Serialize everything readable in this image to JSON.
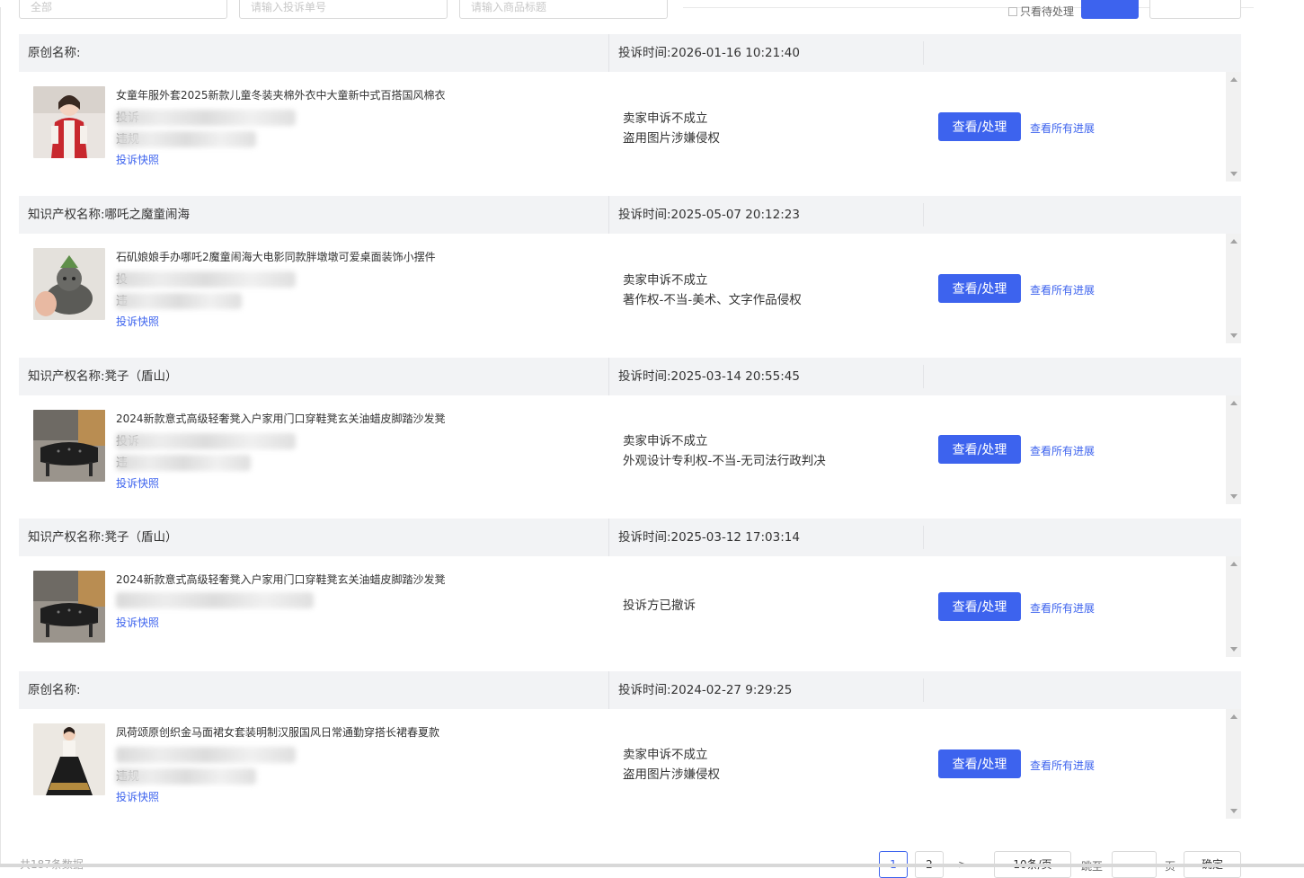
{
  "filters": {
    "f1_placeholder": "全部",
    "f2_placeholder": "请输入投诉单号",
    "f3_placeholder": "请输入商品标题",
    "checkbox_label": "只看待处理",
    "search_label": "",
    "export_label": ""
  },
  "labels": {
    "view_button": "查看/处理",
    "progress_link": "查看所有进展",
    "snapshot_link": "投诉快照",
    "complaint_prefix": "投诉",
    "violation_prefix": "违规"
  },
  "complaints": [
    {
      "header_title": "原创名称:",
      "time": "投诉时间:2026-01-16 10:21:40",
      "product_title": "女童年服外套2025新款儿童冬装夹棉外衣中大童新中式百搭国风棉衣",
      "row1_label": "投诉",
      "row2_label": "违规",
      "status_line1": "卖家申诉不成立",
      "status_line2": "盗用图片涉嫌侵权",
      "thumb_icon": "product-thumbnail-girl-jacket"
    },
    {
      "header_title": "知识产权名称:哪吒之魔童闹海",
      "time": "投诉时间:2025-05-07 20:12:23",
      "product_title": "石矶娘娘手办哪吒2魔童闹海大电影同款胖墩墩可爱桌面装饰小摆件",
      "row1_label": "投",
      "row2_label": "违",
      "status_line1": "卖家申诉不成立",
      "status_line2": "著作权-不当-美术、文字作品侵权",
      "thumb_icon": "product-thumbnail-figurine"
    },
    {
      "header_title": "知识产权名称:凳子（盾山）",
      "time": "投诉时间:2025-03-14 20:55:45",
      "product_title": "2024新款意式高级轻奢凳入户家用门口穿鞋凳玄关油蜡皮脚踏沙发凳",
      "row1_label": "投诉",
      "row2_label": "违",
      "status_line1": "卖家申诉不成立",
      "status_line2": "外观设计专利权-不当-无司法行政判决",
      "thumb_icon": "product-thumbnail-stool"
    },
    {
      "header_title": "知识产权名称:凳子（盾山）",
      "time": "投诉时间:2025-03-12 17:03:14",
      "product_title": "2024新款意式高级轻奢凳入户家用门口穿鞋凳玄关油蜡皮脚踏沙发凳",
      "row1_label": "",
      "row2_label": "",
      "status_line1": "投诉方已撤诉",
      "status_line2": "",
      "thumb_icon": "product-thumbnail-stool"
    },
    {
      "header_title": "原创名称:",
      "time": "投诉时间:2024-02-27 9:29:25",
      "product_title": "凤荷颂原创织金马面裙女套装明制汉服国风日常通勤穿搭长裙春夏款",
      "row1_label": "",
      "row2_label": "违规",
      "status_line1": "卖家申诉不成立",
      "status_line2": "盗用图片涉嫌侵权",
      "thumb_icon": "product-thumbnail-skirt"
    }
  ],
  "footer": {
    "total_text": "共187条数据",
    "page1": "1",
    "page2": "2",
    "next": ">",
    "page_size": "10条/页",
    "goto_label": "跳至",
    "goto_unit": "页",
    "confirm_label": "确定"
  },
  "colors": {
    "primary": "#3d63ee",
    "header_bg": "#f2f3f5"
  }
}
